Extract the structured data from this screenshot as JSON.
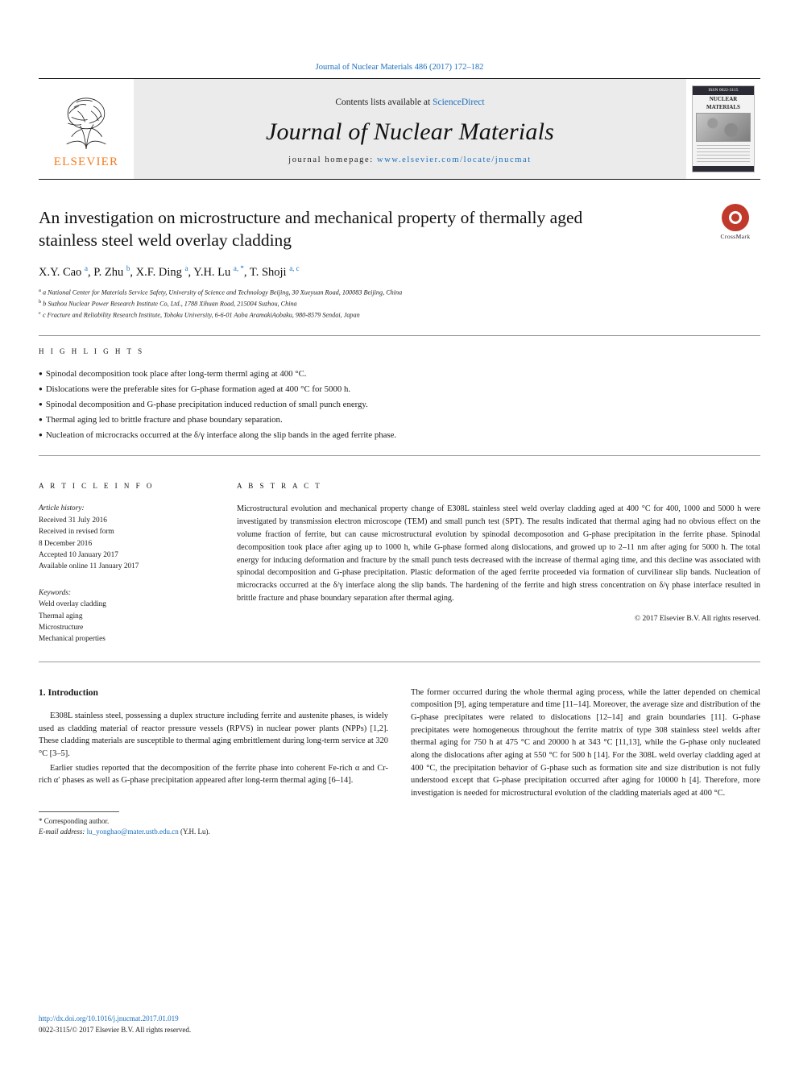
{
  "journal_ref": "Journal of Nuclear Materials 486 (2017) 172–182",
  "masthead": {
    "contents_prefix": "Contents lists available at ",
    "sciencedirect": "ScienceDirect",
    "journal_title": "Journal of Nuclear Materials",
    "homepage_prefix": "journal homepage: ",
    "homepage_url": "www.elsevier.com/locate/jnucmat",
    "publisher": "ELSEVIER",
    "cover": {
      "top_line": "ISSN 0022-3115",
      "title_line1": "NUCLEAR",
      "title_line2": "MATERIALS"
    }
  },
  "article": {
    "title": "An investigation on microstructure and mechanical property of thermally aged stainless steel weld overlay cladding",
    "crossmark_label": "CrossMark",
    "authors_html": "X.Y. Cao <sup>a</sup>, P. Zhu <sup>b</sup>, X.F. Ding <sup>a</sup>, Y.H. Lu <sup>a, *</sup>, T. Shoji <sup>a, c</sup>",
    "affiliations": [
      "a National Center for Materials Service Safety, University of Science and Technology Beijing, 30 Xueyuan Road, 100083 Beijing, China",
      "b Suzhou Nuclear Power Research Institute Co, Ltd., 1788 Xihuan Road, 215004 Suzhou, China",
      "c Fracture and Reliability Research Institute, Tohoku University, 6-6-01 Aoba AramakiAobaku, 980-8579 Sendai, Japan"
    ]
  },
  "highlights": {
    "heading": "H I G H L I G H T S",
    "items": [
      "Spinodal decomposition took place after long-term therml aging at 400 °C.",
      "Dislocations were the preferable sites for G-phase formation aged at 400 °C for 5000 h.",
      "Spinodal decomposition and G-phase precipitation induced reduction of small punch energy.",
      "Thermal aging led to brittle fracture and phase boundary separation.",
      "Nucleation of microcracks occurred at the δ/γ interface along the slip bands in the aged ferrite phase."
    ]
  },
  "article_info": {
    "heading": "A R T I C L E   I N F O",
    "history_label": "Article history:",
    "history": [
      "Received 31 July 2016",
      "Received in revised form",
      "8 December 2016",
      "Accepted 10 January 2017",
      "Available online 11 January 2017"
    ],
    "keywords_label": "Keywords:",
    "keywords": [
      "Weld overlay cladding",
      "Thermal aging",
      "Microstructure",
      "Mechanical properties"
    ]
  },
  "abstract": {
    "heading": "A B S T R A C T",
    "text": "Microstructural evolution and mechanical property change of E308L stainless steel weld overlay cladding aged at 400 °C for 400, 1000 and 5000 h were investigated by transmission electron microscope (TEM) and small punch test (SPT). The results indicated that thermal aging had no obvious effect on the volume fraction of ferrite, but can cause microstructural evolution by spinodal decomposotion and G-phase precipitation in the ferrite phase. Spinodal decomposition took place after aging up to 1000 h, while G-phase formed along dislocations, and growed up to 2–11 nm after aging for 5000 h. The total energy for inducing deformation and fracture by the small punch tests decreased with the increase of thermal aging time, and this decline was associated with spinodal decomposition and G-phase precipitation. Plastic deformation of the aged ferrite proceeded via formation of curvilinear slip bands. Nucleation of microcracks occurred at the δ/γ interface along the slip bands. The hardening of the ferrite and high stress concentration on δ/γ phase interface resulted in brittle fracture and phase boundary separation after thermal aging.",
    "copyright": "© 2017 Elsevier B.V. All rights reserved."
  },
  "body": {
    "section_number": "1.",
    "section_title": "Introduction",
    "left_paragraphs": [
      "E308L stainless steel, possessing a duplex structure including ferrite and austenite phases, is widely used as cladding material of reactor pressure vessels (RPVS) in nuclear power plants (NPPs) [1,2]. These cladding materials are susceptible to thermal aging embrittlement during long-term service at 320 °C [3–5].",
      "Earlier studies reported that the decomposition of the ferrite phase into coherent Fe-rich α and Cr-rich α′ phases as well as G-phase precipitation appeared after long-term thermal aging [6–14]."
    ],
    "right_paragraphs": [
      "The former occurred during the whole thermal aging process, while the latter depended on chemical composition [9], aging temperature and time [11–14]. Moreover, the average size and distribution of the G-phase precipitates were related to dislocations [12–14] and grain boundaries [11]. G-phase precipitates were homogeneous throughout the ferrite matrix of type 308 stainless steel welds after thermal aging for 750 h at 475 °C and 20000 h at 343 °C [11,13], while the G-phase only nucleated along the dislocations after aging at 550 °C for 500 h [14]. For the 308L weld overlay cladding aged at 400 °C, the precipitation behavior of G-phase such as formation site and size distribution is not fully understood except that G-phase precipitation occurred after aging for 10000 h [4]. Therefore, more investigation is needed for microstructural evolution of the cladding materials aged at 400 °C."
    ],
    "footnote_star": "* Corresponding author.",
    "footnote_email_label": "E-mail address: ",
    "footnote_email": "lu_yonghao@mater.ustb.edu.cn",
    "footnote_email_suffix": " (Y.H. Lu)."
  },
  "footer": {
    "doi": "http://dx.doi.org/10.1016/j.jnucmat.2017.01.019",
    "issn_line": "0022-3115/© 2017 Elsevier B.V. All rights reserved."
  },
  "colors": {
    "link": "#1a6ebd",
    "elsevier_orange": "#f47c20",
    "crossmark_red": "#c0392b",
    "masthead_bg": "#ebebeb"
  }
}
